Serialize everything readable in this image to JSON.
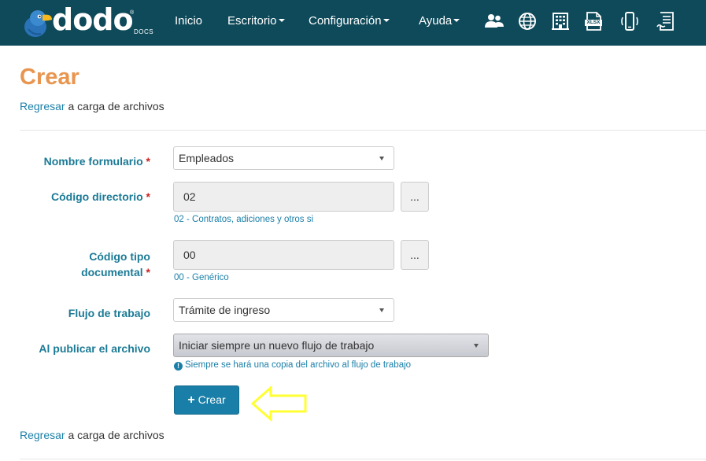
{
  "navbar": {
    "logo_text": "dodo",
    "logo_reg": "®",
    "logo_sub": "DOCS",
    "menu": [
      {
        "label": "Inicio",
        "dropdown": false
      },
      {
        "label": "Escritorio",
        "dropdown": true
      },
      {
        "label": "Configuración",
        "dropdown": true
      },
      {
        "label": "Ayuda",
        "dropdown": true
      }
    ],
    "icons": [
      "users-icon",
      "globe-icon",
      "building-icon",
      "xlsx-file-icon",
      "mobile-vibrate-icon",
      "document-list-icon"
    ],
    "xlsx_label": "XLSX"
  },
  "page": {
    "title": "Crear",
    "back_link_text": "Regresar",
    "back_link_suffix": " a carga de archivos"
  },
  "form": {
    "required_mark": "*",
    "nombre_formulario": {
      "label": "Nombre formulario",
      "value": "Empleados"
    },
    "codigo_directorio": {
      "label": "Código directorio",
      "value": "02",
      "button": "...",
      "help": "02 - Contratos, adiciones y otros si"
    },
    "codigo_tipo_documental": {
      "label_line1": "Código tipo",
      "label_line2": "documental",
      "value": "00",
      "button": "...",
      "help": "00 - Genérico"
    },
    "flujo_de_trabajo": {
      "label": "Flujo de trabajo",
      "value": "Trámite de ingreso"
    },
    "al_publicar": {
      "label": "Al publicar el archivo",
      "value": "Iniciar siempre un nuevo flujo de trabajo",
      "info_glyph": "!",
      "help": "Siempre se hará una copia del archivo al flujo de trabajo"
    },
    "submit": {
      "plus": "+",
      "label": "Crear"
    }
  },
  "colors": {
    "navbar_bg": "#0e4a5a",
    "title": "#e8954f",
    "label": "#1b7a96",
    "link": "#1a7fa8",
    "primary_button": "#1a7fa8",
    "required": "#cc2222",
    "annotation_arrow": "#ffff33"
  }
}
